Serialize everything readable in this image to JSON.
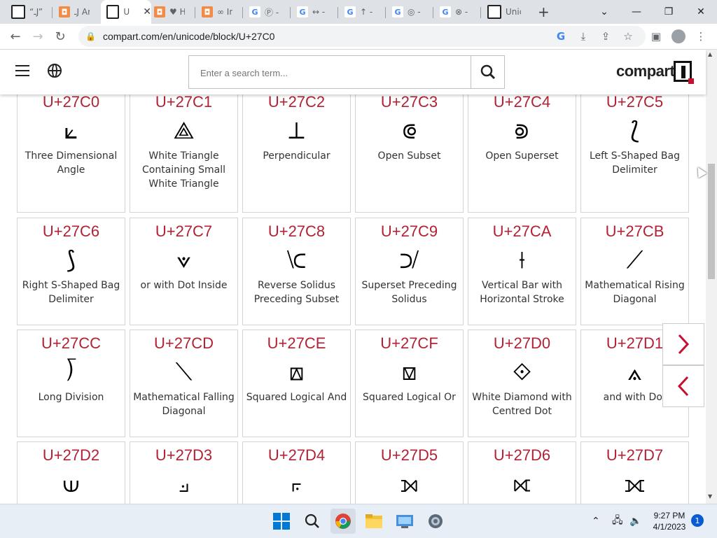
{
  "browser": {
    "tabs": [
      {
        "icon": "compart-icon",
        "title": "“ـJ” U"
      },
      {
        "icon": "orange-site-icon",
        "title": "ـJ Ari"
      },
      {
        "icon": "compart-icon",
        "title": "U",
        "active": true
      },
      {
        "icon": "orange-site-icon",
        "title": "♥ He"
      },
      {
        "icon": "orange-site-icon",
        "title": "∞ In"
      },
      {
        "icon": "google-icon",
        "title": "Ⓟ -"
      },
      {
        "icon": "google-icon",
        "title": "↔ - G"
      },
      {
        "icon": "google-icon",
        "title": "↑ - Gi"
      },
      {
        "icon": "google-icon",
        "title": "◎ - G"
      },
      {
        "icon": "google-icon",
        "title": "⊗ - G"
      },
      {
        "icon": "compart-icon",
        "title": "Unico"
      }
    ],
    "url": "compart.com/en/unicode/block/U+27C0"
  },
  "site": {
    "search_placeholder": "Enter a search term...",
    "logo_text": "compart"
  },
  "cells": [
    {
      "code": "U+27C0",
      "glyph": "⟀",
      "name": "Three Dimensional Angle"
    },
    {
      "code": "U+27C1",
      "glyph": "⟁",
      "name": "White Triangle Containing Small White Triangle"
    },
    {
      "code": "U+27C2",
      "glyph": "⟂",
      "name": "Perpendicular"
    },
    {
      "code": "U+27C3",
      "glyph": "⟃",
      "name": "Open Subset"
    },
    {
      "code": "U+27C4",
      "glyph": "⟄",
      "name": "Open Superset"
    },
    {
      "code": "U+27C5",
      "glyph": "⟅",
      "name": "Left S-Shaped Bag Delimiter"
    },
    {
      "code": "U+27C6",
      "glyph": "⟆",
      "name": "Right S-Shaped Bag Delimiter"
    },
    {
      "code": "U+27C7",
      "glyph": "⟇",
      "name": "or with Dot Inside"
    },
    {
      "code": "U+27C8",
      "glyph": "⟈",
      "name": "Reverse Solidus Preceding Subset"
    },
    {
      "code": "U+27C9",
      "glyph": "⟉",
      "name": "Superset Preceding Solidus"
    },
    {
      "code": "U+27CA",
      "glyph": "⟊",
      "name": "Vertical Bar with Horizontal Stroke"
    },
    {
      "code": "U+27CB",
      "glyph": "⟋",
      "name": "Mathematical Rising Diagonal"
    },
    {
      "code": "U+27CC",
      "glyph": "⟌",
      "name": "Long Division"
    },
    {
      "code": "U+27CD",
      "glyph": "⟍",
      "name": "Mathematical Falling Diagonal"
    },
    {
      "code": "U+27CE",
      "glyph": "⟎",
      "name": "Squared Logical And"
    },
    {
      "code": "U+27CF",
      "glyph": "⟏",
      "name": "Squared Logical Or"
    },
    {
      "code": "U+27D0",
      "glyph": "⟐",
      "name": "White Diamond with Centred Dot"
    },
    {
      "code": "U+27D1",
      "glyph": "⟑",
      "name": "and with Dot"
    },
    {
      "code": "U+27D2",
      "glyph": "⟒",
      "name": ""
    },
    {
      "code": "U+27D3",
      "glyph": "⟓",
      "name": ""
    },
    {
      "code": "U+27D4",
      "glyph": "⟔",
      "name": ""
    },
    {
      "code": "U+27D5",
      "glyph": "⟕",
      "name": ""
    },
    {
      "code": "U+27D6",
      "glyph": "⟖",
      "name": ""
    },
    {
      "code": "U+27D7",
      "glyph": "⟗",
      "name": ""
    }
  ],
  "taskbar": {
    "time": "9:27 PM",
    "date": "4/1/2023",
    "notifications": "1"
  },
  "colors": {
    "accent": "#b22234",
    "tab_bg": "#dee1e6",
    "taskbar_bg": "#e8eef6"
  }
}
